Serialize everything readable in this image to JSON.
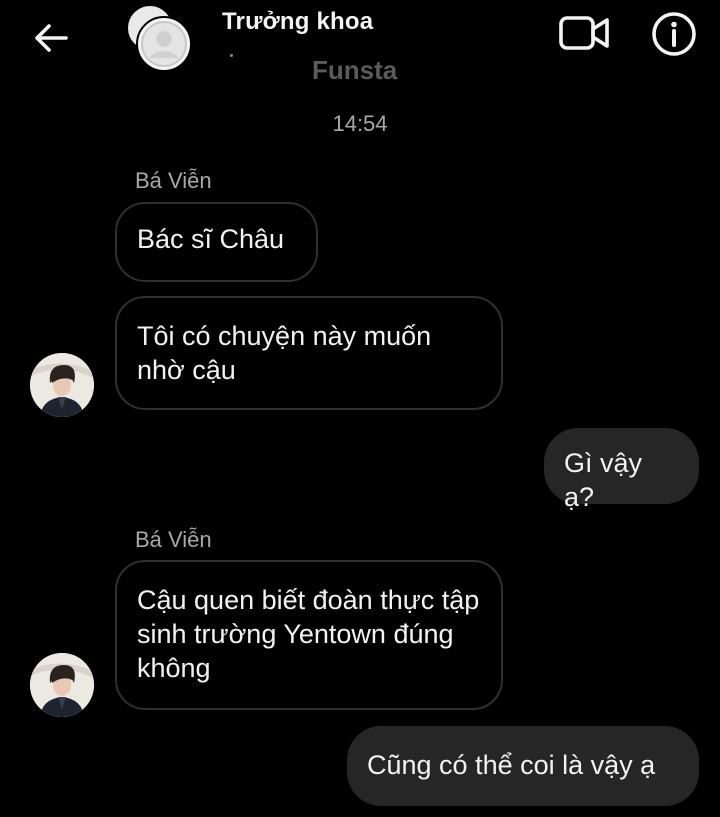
{
  "header": {
    "title": "Trưởng khoa",
    "subtitle": "Funsta"
  },
  "chat": {
    "timestamp": "14:54",
    "groups": [
      {
        "sender": "Bá Viễn",
        "messages": [
          "Bác sĩ Châu",
          "Tôi có chuyện này muốn nhờ cậu"
        ]
      },
      {
        "sender": "Bá Viễn",
        "messages": [
          "Cậu quen biết đoàn thực tập sinh trường Yentown đúng không"
        ]
      }
    ],
    "outgoing": [
      "Gì vậy ạ?",
      "Cũng có thể coi là vậy ạ"
    ]
  },
  "colors": {
    "background": "#000000",
    "outgoing_bubble": "#262626",
    "incoming_border": "#2f2f2f",
    "muted_text": "#a8a8a8"
  },
  "icons": {
    "back": "arrow-left-icon",
    "video": "video-camera-icon",
    "info": "info-icon",
    "group_avatar": "group-avatar-icon"
  }
}
